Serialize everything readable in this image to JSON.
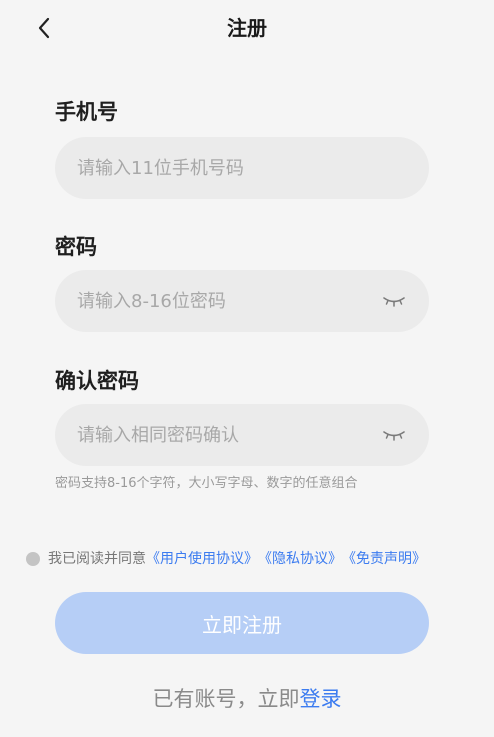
{
  "header": {
    "title": "注册",
    "back_icon": "chevron-left-icon"
  },
  "phone": {
    "label": "手机号",
    "placeholder": "请输入11位手机号码"
  },
  "password": {
    "label": "密码",
    "placeholder": "请输入8-16位密码",
    "visibility_icon": "eye-closed-icon"
  },
  "confirm_password": {
    "label": "确认密码",
    "placeholder": "请输入相同密码确认",
    "visibility_icon": "eye-closed-icon"
  },
  "hint": "密码支持8-16个字符，大小写字母、数字的任意组合",
  "agreement": {
    "prefix": "我已阅读并同意",
    "user_agreement": "《用户使用协议》",
    "privacy_agreement": "《隐私协议》",
    "disclaimer": "《免责声明》"
  },
  "register_button": "立即注册",
  "login": {
    "prefix": "已有账号，立即",
    "link": "登录"
  },
  "colors": {
    "background": "#f5f5f5",
    "field_bg": "#ebebeb",
    "accent": "#3c7cf0",
    "button_disabled": "#b6cef6"
  }
}
